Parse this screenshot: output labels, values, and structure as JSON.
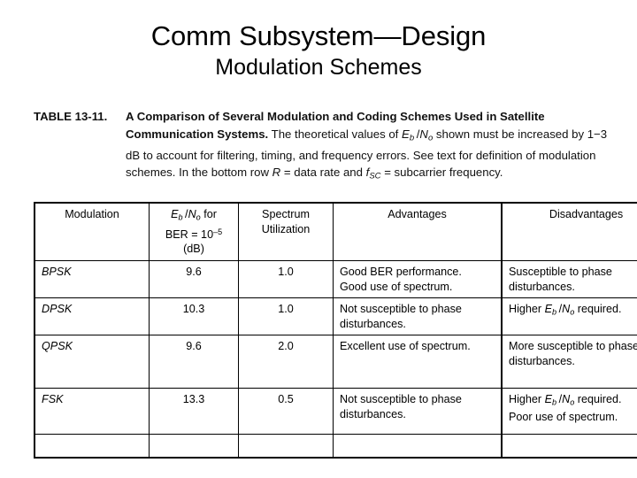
{
  "slide": {
    "title": "Comm Subsystem—Design",
    "subtitle": "Modulation Schemes"
  },
  "caption": {
    "label": "TABLE 13-11.",
    "bold_part_1": "A Comparison of Several Modulation and Coding Schemes Used in Satellite Communication Systems.",
    "rest_1": "The theoretical values of",
    "sym_ebno": "Eb/No",
    "rest_2": "shown must be increased by 1−3 dB to account for filtering, timing, and frequency errors. See text for definition of modulation schemes. In the bottom row",
    "sym_r": "R",
    "rest_3": "= data rate and",
    "sym_fsc": "fSC",
    "rest_4": "= subcarrier frequency."
  },
  "table": {
    "headers": {
      "modulation": "Modulation",
      "ebno_line1": "Eb /No for",
      "ebno_line2": "BER = 10–5",
      "ebno_line3": "(dB)",
      "spectrum_line1": "Spectrum",
      "spectrum_line2": "Utilization",
      "advantages": "Advantages",
      "disadvantages": "Disadvantages"
    },
    "rows": [
      {
        "modulation": "BPSK",
        "ebno": "9.6",
        "spectrum": "1.0",
        "advantages": [
          "Good BER performance.",
          "Good use of spectrum."
        ],
        "disadvantages": [
          "Susceptible to phase",
          "disturbances."
        ]
      },
      {
        "modulation": "DPSK",
        "ebno": "10.3",
        "spectrum": "1.0",
        "advantages": [
          "Not susceptible to phase",
          "disturbances."
        ],
        "disadvantages": [
          "Higher Eb/No required."
        ]
      },
      {
        "modulation": "QPSK",
        "ebno": "9.6",
        "spectrum": "2.0",
        "advantages": [
          "Excellent use of spectrum."
        ],
        "disadvantages": [
          "More susceptible to phase",
          "disturbances."
        ]
      },
      {
        "modulation": "FSK",
        "ebno": "13.3",
        "spectrum": "0.5",
        "advantages": [
          "Not susceptible to phase",
          "disturbances."
        ],
        "disadvantages": [
          "Higher Eb/No required.",
          "Poor use of spectrum."
        ]
      }
    ]
  },
  "colors": {
    "background": "#ffffff",
    "text": "#000000",
    "rule": "#000000"
  }
}
